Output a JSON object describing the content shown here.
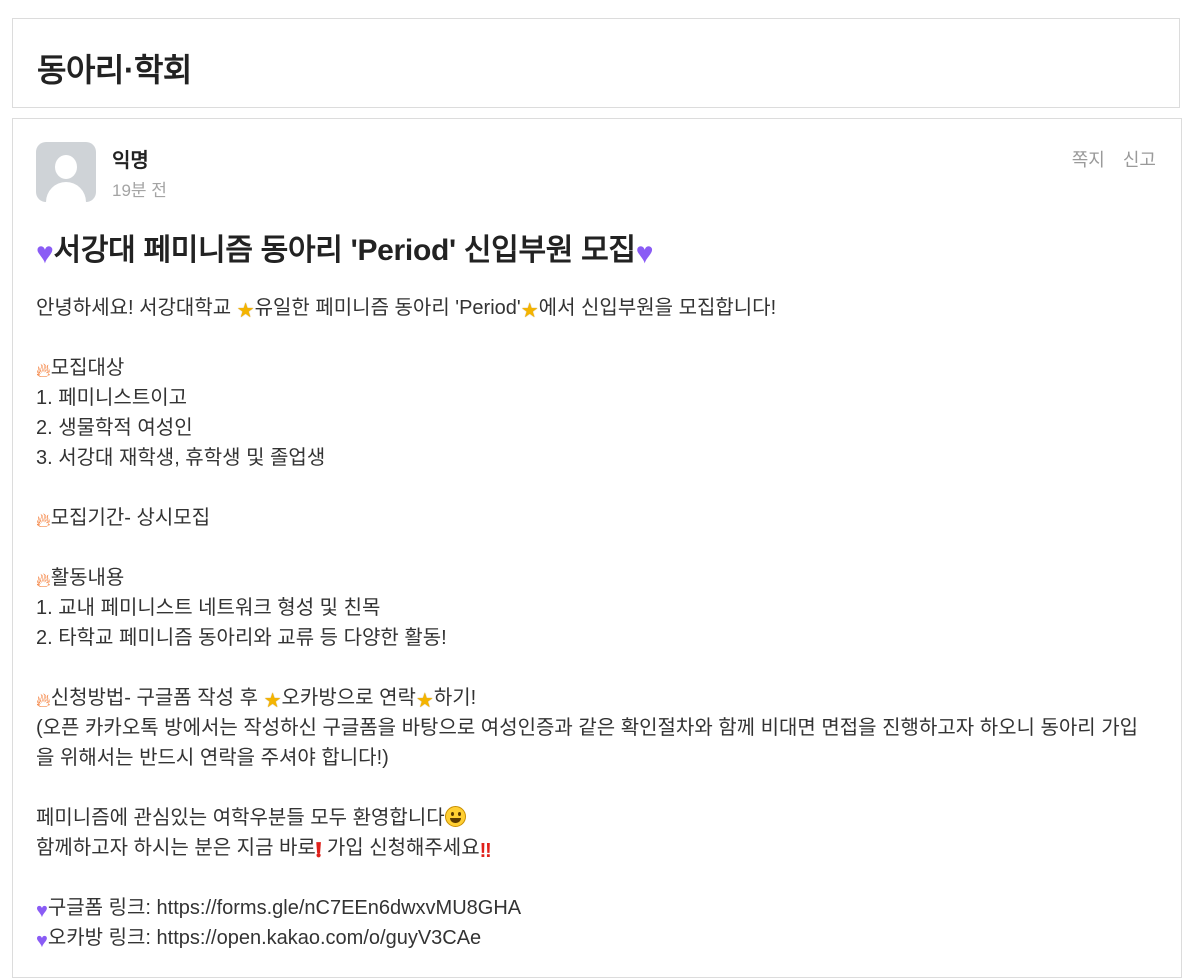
{
  "board": {
    "title": "동아리·학회"
  },
  "post": {
    "author": "익명",
    "time": "19분 전",
    "actions": {
      "message": "쪽지",
      "report": "신고"
    },
    "title": "서강대 페미니즘 동아리 'Period' 신입부원 모집",
    "body": {
      "intro_a": "안녕하세요! 서강대학교 ",
      "intro_b": "유일한 페미니즘 동아리 'Period'",
      "intro_c": "에서 신입부원을 모집합니다!",
      "target_heading": "모집대상",
      "target_items": [
        "1. 페미니스트이고",
        "2. 생물학적 여성인",
        "3. 서강대 재학생, 휴학생 및 졸업생"
      ],
      "period": "모집기간- 상시모집",
      "activity_heading": "활동내용",
      "activity_items": [
        "1. 교내 페미니스트 네트워크 형성 및 친목",
        "2. 타학교 페미니즘 동아리와 교류 등 다양한 활동!"
      ],
      "apply_a": "신청방법- 구글폼 작성 후 ",
      "apply_b": "오카방으로 연락",
      "apply_c": "하기!",
      "apply_note": "(오픈 카카오톡 방에서는 작성하신 구글폼을 바탕으로 여성인증과 같은 확인절차와 함께 비대면 면접을 진행하고자 하오니 동아리 가입을 위해서는 반드시 연락을 주셔야 합니다!)",
      "welcome": "페미니즘에 관심있는 여학우분들 모두 환영합니다",
      "join_a": "함께하고자 하시는 분은 지금 바로",
      "join_b": " 가입 신청해주세요",
      "google_form": "구글폼 링크: https://forms.gle/nC7EEn6dwxvMU8GHA",
      "open_chat": "오카방 링크: https://open.kakao.com/o/guyV3CAe"
    }
  },
  "icons": {
    "heart": "purple-heart-icon",
    "star": "star-icon",
    "fire": "fire-icon",
    "smile": "smiley-icon",
    "exclamation": "red-exclamation-icon"
  },
  "colors": {
    "heart": "#8a5cf5",
    "star": "#f4b400",
    "fire": "#f26b1d",
    "exclamation": "#e0211b"
  }
}
